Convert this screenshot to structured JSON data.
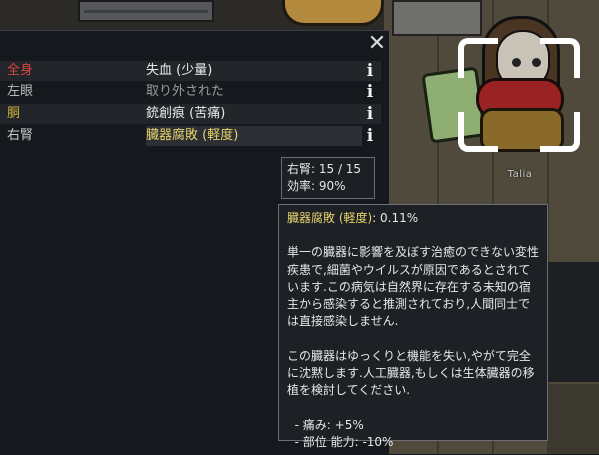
{
  "colors": {
    "part_critical": "#d9463e",
    "part_minor": "#b9b9b9",
    "part_torso": "#d4b23c",
    "part_kidney": "#c9c9c9",
    "cond_normal": "#eaeaea",
    "cond_gray": "#9a9a9a",
    "cond_yellow": "#e7d36a"
  },
  "pawn": {
    "name": "Talia"
  },
  "health_rows": [
    {
      "part": "全身",
      "condition": "失血 (少量)",
      "info_icon": "info-icon"
    },
    {
      "part": "左眼",
      "condition": "取り外された",
      "info_icon": "info-icon"
    },
    {
      "part": "胴",
      "condition": "銃創痕 (苦痛)",
      "info_icon": "info-icon"
    },
    {
      "part": "右腎",
      "condition": "臓器腐敗 (軽度)",
      "info_icon": "info-icon"
    }
  ],
  "close_icon": "close-icon",
  "statbox": {
    "line1": "右腎:  15 / 15",
    "line2": "効率: 90%"
  },
  "tooltip": {
    "title": "臓器腐敗 (軽度)",
    "title_value": ": 0.11%",
    "desc1": "単一の臓器に影響を及ぼす治癒のできない変性疾患で,細菌やウイルスが原因であるとされています.この病気は自然界に存在する未知の宿主から感染すると推測されており,人間同士では直接感染しません.",
    "desc2": "この臓器はゆっくりと機能を失い,やがて完全に沈黙します.人工臓器,もしくは生体臓器の移植を検討してください.",
    "effect1": "  - 痛み: +5%",
    "effect2": "  - 部位 能力: -10%"
  }
}
